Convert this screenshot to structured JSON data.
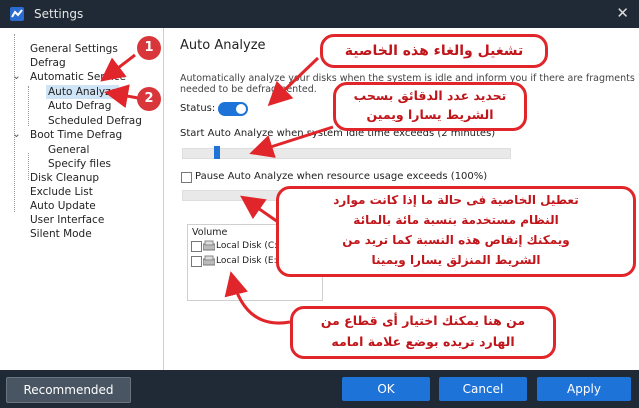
{
  "window": {
    "title": "Settings",
    "close_glyph": "✕"
  },
  "sidebar": {
    "items": [
      {
        "label": "General Settings"
      },
      {
        "label": "Defrag"
      },
      {
        "label": "Automatic Service",
        "expander": "⌄"
      },
      {
        "label": "Auto Analyze",
        "selected": true
      },
      {
        "label": "Auto Defrag"
      },
      {
        "label": "Scheduled Defrag"
      },
      {
        "label": "Boot Time Defrag",
        "expander": "⌄"
      },
      {
        "label": "General"
      },
      {
        "label": "Specify files"
      },
      {
        "label": "Disk Cleanup"
      },
      {
        "label": "Exclude List"
      },
      {
        "label": "Auto Update"
      },
      {
        "label": "User Interface"
      },
      {
        "label": "Silent Mode"
      }
    ]
  },
  "main": {
    "heading": "Auto Analyze",
    "description_line1": "Automatically analyze your disks when the system is idle and inform you if there are fragments",
    "description_line2": "needed to be defragmented.",
    "status_label": "Status:",
    "status_on": true,
    "idle_label": "Start Auto Analyze when system idle time exceeds (2 minutes)",
    "idle_level": 0.1,
    "pause_label": "Pause Auto Analyze when resource usage exceeds (100%)",
    "pause_checked": false,
    "volume_header": "Volume",
    "volumes": [
      {
        "label": "Local Disk (C:)[SSD]",
        "checked": false
      },
      {
        "label": "Local Disk (E:)[SSD]",
        "checked": false
      }
    ]
  },
  "footer": {
    "recommended": "Recommended",
    "ok": "OK",
    "cancel": "Cancel",
    "apply": "Apply"
  },
  "annotations": {
    "badge1": "1",
    "badge2": "2",
    "callout1": "تشغيل والغاء هذه الخاصية",
    "callout2_line1": "تحديد عدد الدقائق بسحب",
    "callout2_line2": "الشريط يسارا ويمين",
    "callout3_line1": "تعطيل الخاصية فى حالة ما إذا كانت موارد",
    "callout3_line2": "النظام مستخدمة بنسبة مائة بالمائة",
    "callout3_line3": "ويمكنك إنقاص هذه النسبة كما تريد من",
    "callout3_line4": "الشريط المنزلق يسارا ويمينا",
    "callout4_line1": "من هنا يمكنك اختيار أى قطاع من",
    "callout4_line2": "الهارد تريده بوضع علامة امامه"
  },
  "colors": {
    "accent": "#1e73d8",
    "annotation_red": "#e0262b",
    "titlebar": "#1f2a36"
  }
}
